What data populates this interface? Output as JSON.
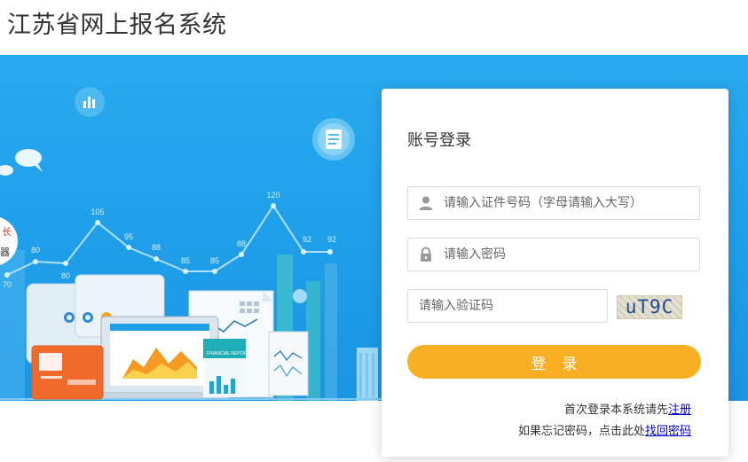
{
  "site": {
    "title": "江苏省网上报名系统"
  },
  "banner": {
    "chart_labels": [
      "70",
      "80",
      "80",
      "105",
      "95",
      "88",
      "85",
      "85",
      "88",
      "120",
      "92",
      "92"
    ],
    "report_label": "FINANCIAL REPORT",
    "left_text": [
      "长",
      "器"
    ]
  },
  "login": {
    "title": "账号登录",
    "id_placeholder": "请输入证件号码（字母请输入大写）",
    "password_placeholder": "请输入密码",
    "captcha_placeholder": "请输入验证码",
    "captcha_text": "uT9C",
    "submit_label": "登录",
    "register_prefix": "首次登录本系统请先",
    "register_link": "注册",
    "forgot_prefix": "如果忘记密码，点击此处",
    "forgot_link": "找回密码"
  },
  "colors": {
    "banner": "#1f9fe9",
    "button": "#f8b022",
    "link": "#0000cc"
  }
}
